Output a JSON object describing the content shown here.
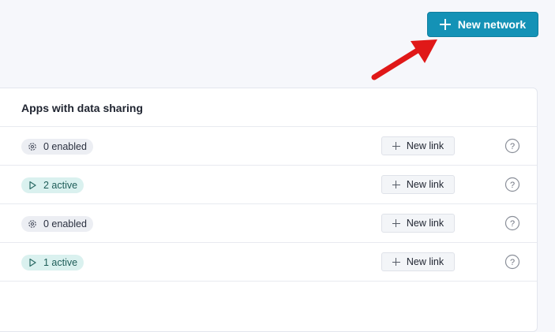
{
  "header": {
    "new_network_label": "New network"
  },
  "card": {
    "title": "Apps with data sharing",
    "rows": [
      {
        "status_icon": "gear-icon",
        "status_label": "0 enabled",
        "status_kind": "enabled",
        "link_label": "New link",
        "help_icon": "question-icon"
      },
      {
        "status_icon": "play-icon",
        "status_label": "2 active",
        "status_kind": "active",
        "link_label": "New link",
        "help_icon": "question-icon"
      },
      {
        "status_icon": "gear-icon",
        "status_label": "0 enabled",
        "status_kind": "enabled",
        "link_label": "New link",
        "help_icon": "question-icon"
      },
      {
        "status_icon": "play-icon",
        "status_label": "1 active",
        "status_kind": "active",
        "link_label": "New link",
        "help_icon": "question-icon"
      }
    ]
  },
  "colors": {
    "primary": "#1492b6",
    "annotation": "#e01818",
    "active_pill_bg": "#daf1ef",
    "enabled_pill_bg": "#eceef3"
  }
}
